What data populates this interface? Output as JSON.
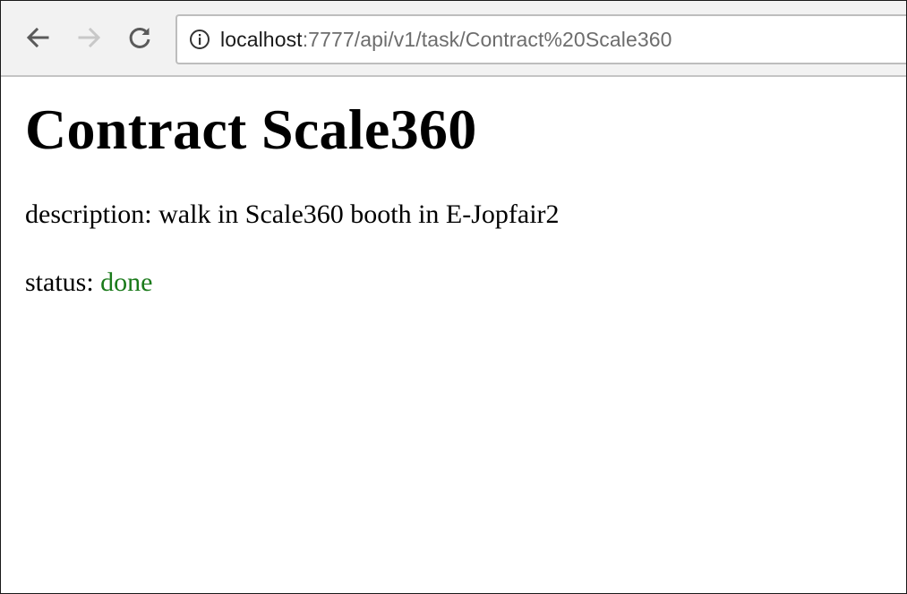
{
  "browser": {
    "url_host": "localhost",
    "url_rest": ":7777/api/v1/task/Contract%20Scale360",
    "icons": {
      "back": "arrow-left-icon",
      "forward": "arrow-right-icon",
      "reload": "reload-icon",
      "site_info": "info-icon"
    }
  },
  "task": {
    "title": "Contract Scale360",
    "description_label": "description:",
    "description_value": "walk in Scale360 booth in E-Jopfair2",
    "status_label": "status:",
    "status_value": "done"
  },
  "colors": {
    "status_done": "#1a7a1a",
    "url_path": "#6d6d6d",
    "toolbar_bg": "#f2f2f2"
  }
}
